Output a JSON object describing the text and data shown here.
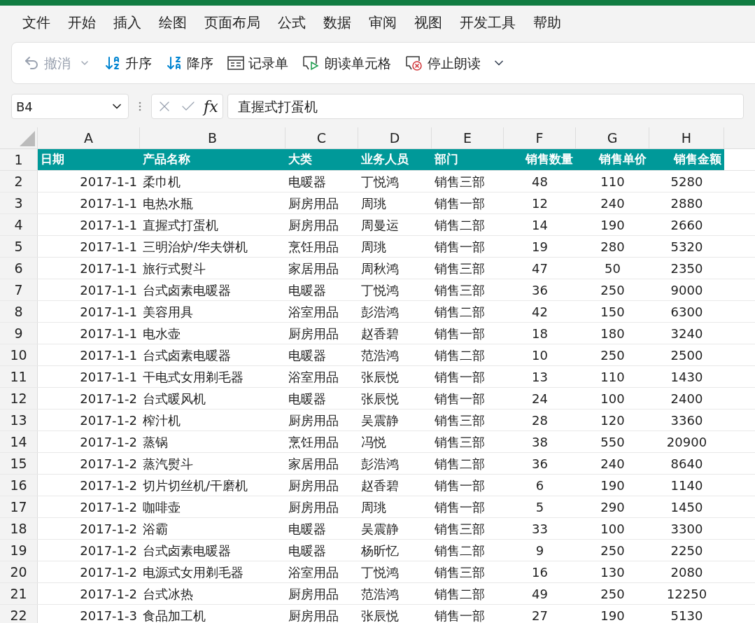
{
  "menu": [
    "文件",
    "开始",
    "插入",
    "绘图",
    "页面布局",
    "公式",
    "数据",
    "审阅",
    "视图",
    "开发工具",
    "帮助"
  ],
  "toolbar": [
    {
      "kind": "undo",
      "label": "撤消",
      "disabled": true
    },
    {
      "kind": "sort-asc",
      "label": "升序",
      "disabled": false
    },
    {
      "kind": "sort-desc",
      "label": "降序",
      "disabled": false
    },
    {
      "kind": "form",
      "label": "记录单",
      "disabled": false
    },
    {
      "kind": "speak",
      "label": "朗读单元格",
      "disabled": false
    },
    {
      "kind": "stop",
      "label": "停止朗读",
      "disabled": false
    }
  ],
  "formula_bar": {
    "name_box": "B4",
    "fx": "fx",
    "value": "直握式打蛋机"
  },
  "columns": [
    "A",
    "B",
    "C",
    "D",
    "E",
    "F",
    "G",
    "H"
  ],
  "header_row": {
    "number": "1",
    "cells": [
      "日期",
      "产品名称",
      "大类",
      "业务人员",
      "部门",
      "销售数量",
      "销售单价",
      "销售金额"
    ]
  },
  "rows": [
    {
      "number": "2",
      "cells": [
        "2017-1-1",
        "柔巾机",
        "电暖器",
        "丁悦鸿",
        "销售三部",
        "48",
        "110",
        "5280"
      ]
    },
    {
      "number": "3",
      "cells": [
        "2017-1-1",
        "电热水瓶",
        "厨房用品",
        "周珧",
        "销售一部",
        "12",
        "240",
        "2880"
      ]
    },
    {
      "number": "4",
      "cells": [
        "2017-1-1",
        "直握式打蛋机",
        "厨房用品",
        "周曼运",
        "销售二部",
        "14",
        "190",
        "2660"
      ]
    },
    {
      "number": "5",
      "cells": [
        "2017-1-1",
        "三明治炉/华夫饼机",
        "烹饪用品",
        "周珧",
        "销售一部",
        "19",
        "280",
        "5320"
      ]
    },
    {
      "number": "6",
      "cells": [
        "2017-1-1",
        "旅行式熨斗",
        "家居用品",
        "周秋鸿",
        "销售三部",
        "47",
        "50",
        "2350"
      ]
    },
    {
      "number": "7",
      "cells": [
        "2017-1-1",
        "台式卤素电暖器",
        "电暖器",
        "丁悦鸿",
        "销售三部",
        "36",
        "250",
        "9000"
      ]
    },
    {
      "number": "8",
      "cells": [
        "2017-1-1",
        "美容用具",
        "浴室用品",
        "彭浩鸿",
        "销售二部",
        "42",
        "150",
        "6300"
      ]
    },
    {
      "number": "9",
      "cells": [
        "2017-1-1",
        "电水壶",
        "厨房用品",
        "赵香碧",
        "销售一部",
        "18",
        "180",
        "3240"
      ]
    },
    {
      "number": "10",
      "cells": [
        "2017-1-1",
        "台式卤素电暖器",
        "电暖器",
        "范浩鸿",
        "销售二部",
        "10",
        "250",
        "2500"
      ]
    },
    {
      "number": "11",
      "cells": [
        "2017-1-1",
        "干电式女用剃毛器",
        "浴室用品",
        "张辰悦",
        "销售一部",
        "13",
        "110",
        "1430"
      ]
    },
    {
      "number": "12",
      "cells": [
        "2017-1-2",
        "台式暖风机",
        "电暖器",
        "张辰悦",
        "销售一部",
        "24",
        "100",
        "2400"
      ]
    },
    {
      "number": "13",
      "cells": [
        "2017-1-2",
        "榨汁机",
        "厨房用品",
        "吴震静",
        "销售三部",
        "28",
        "120",
        "3360"
      ]
    },
    {
      "number": "14",
      "cells": [
        "2017-1-2",
        "蒸锅",
        "烹饪用品",
        "冯悦",
        "销售三部",
        "38",
        "550",
        "20900"
      ]
    },
    {
      "number": "15",
      "cells": [
        "2017-1-2",
        "蒸汽熨斗",
        "家居用品",
        "彭浩鸿",
        "销售二部",
        "36",
        "240",
        "8640"
      ]
    },
    {
      "number": "16",
      "cells": [
        "2017-1-2",
        "切片切丝机/干磨机",
        "厨房用品",
        "赵香碧",
        "销售一部",
        "6",
        "190",
        "1140"
      ]
    },
    {
      "number": "17",
      "cells": [
        "2017-1-2",
        "咖啡壶",
        "厨房用品",
        "周珧",
        "销售一部",
        "5",
        "290",
        "1450"
      ]
    },
    {
      "number": "18",
      "cells": [
        "2017-1-2",
        "浴霸",
        "电暖器",
        "吴震静",
        "销售三部",
        "33",
        "100",
        "3300"
      ]
    },
    {
      "number": "19",
      "cells": [
        "2017-1-2",
        "台式卤素电暖器",
        "电暖器",
        "杨昕忆",
        "销售二部",
        "9",
        "250",
        "2250"
      ]
    },
    {
      "number": "20",
      "cells": [
        "2017-1-2",
        "电源式女用剃毛器",
        "浴室用品",
        "丁悦鸿",
        "销售三部",
        "16",
        "130",
        "2080"
      ]
    },
    {
      "number": "21",
      "cells": [
        "2017-1-2",
        "台式冰热",
        "厨房用品",
        "范浩鸿",
        "销售二部",
        "49",
        "250",
        "12250"
      ]
    },
    {
      "number": "22",
      "cells": [
        "2017-1-3",
        "食品加工机",
        "厨房用品",
        "张辰悦",
        "销售一部",
        "27",
        "190",
        "5130"
      ]
    }
  ]
}
